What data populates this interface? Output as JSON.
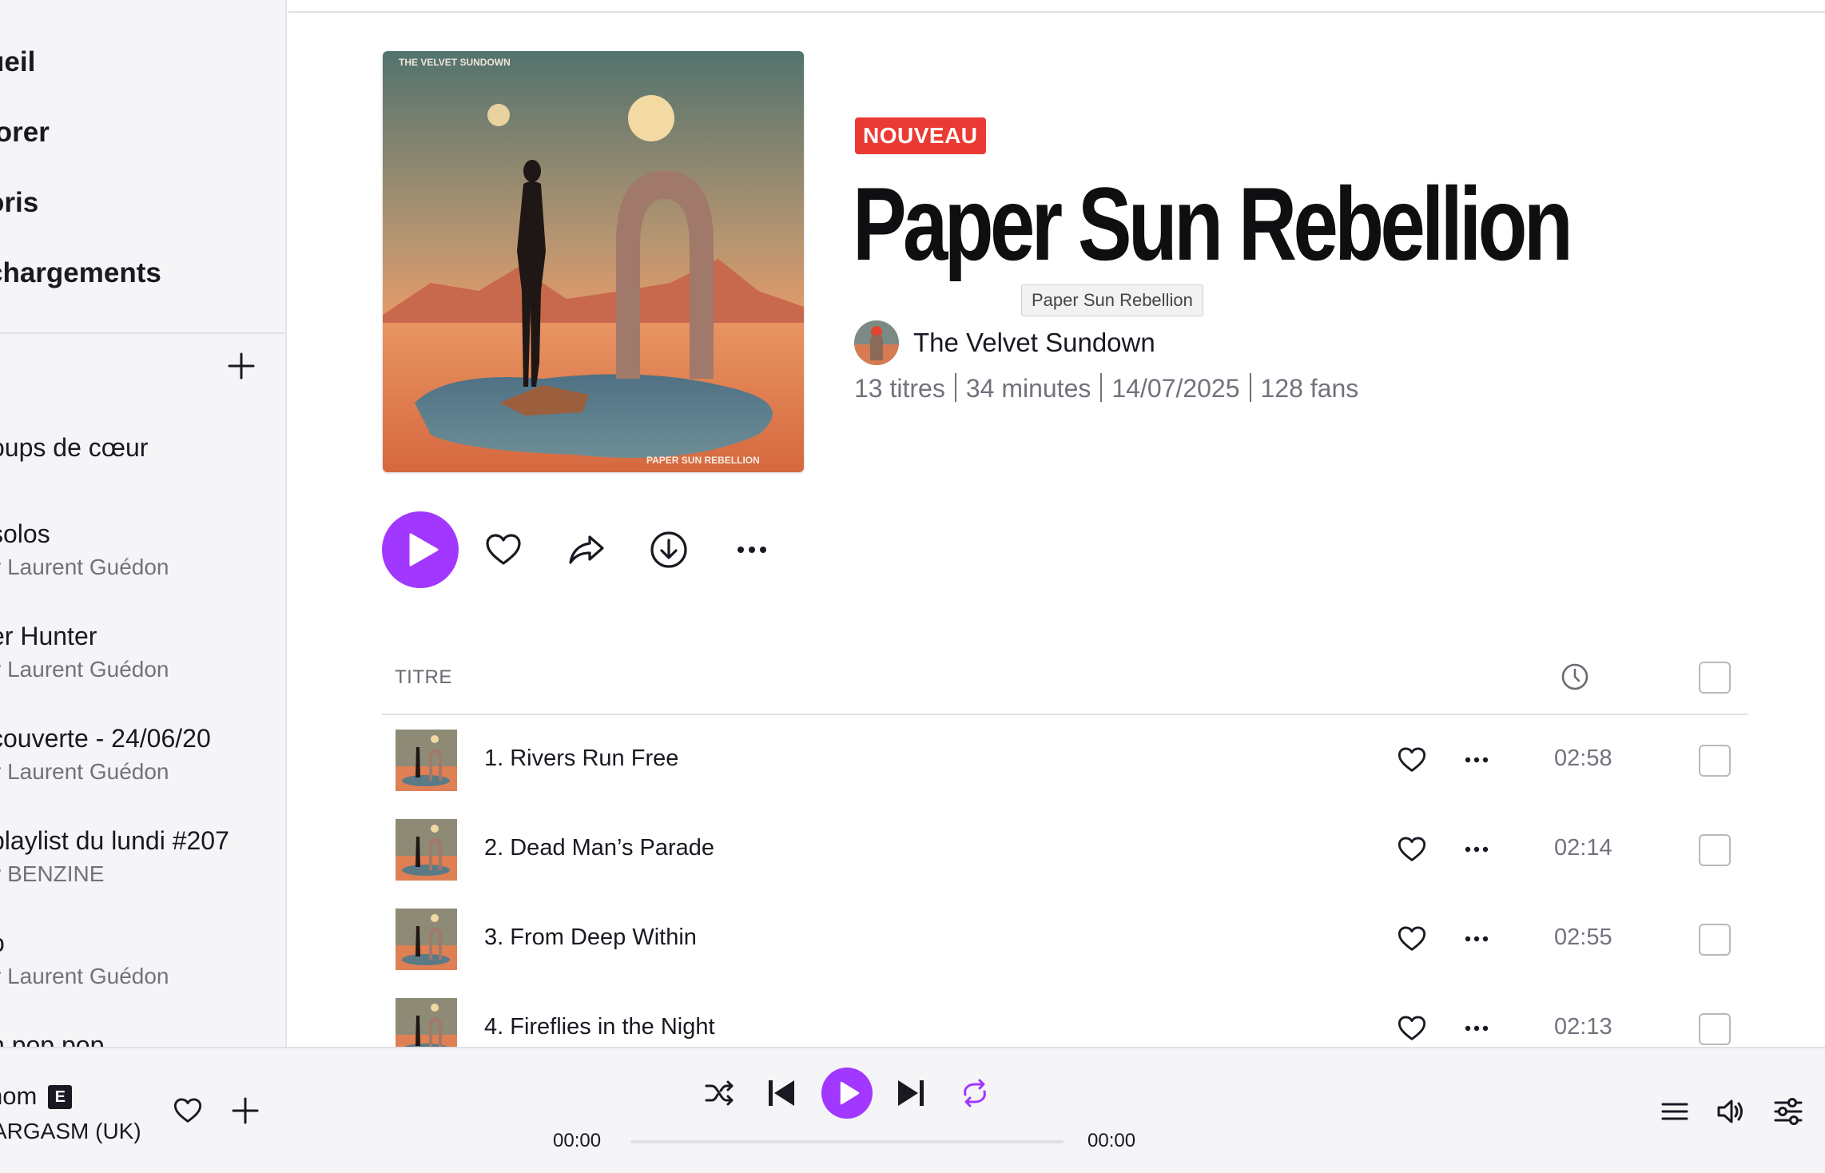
{
  "colors": {
    "accent": "#a238ff",
    "badge": "#ea3a33",
    "text": "#191922",
    "muted": "#72727d"
  },
  "sidebar": {
    "nav": [
      {
        "label": "ueil"
      },
      {
        "label": "lorer"
      },
      {
        "label": "oris"
      },
      {
        "label": "chargements"
      }
    ],
    "add_icon": "plus-icon",
    "playlists": [
      {
        "title": "oups de cœur",
        "subtitle": ""
      },
      {
        "title": "solos",
        "subtitle": "r Laurent Guédon"
      },
      {
        "title": "er Hunter",
        "subtitle": "r Laurent Guédon"
      },
      {
        "title": "couverte - 24/06/20",
        "subtitle": "r Laurent Guédon"
      },
      {
        "title": "playlist du lundi #207",
        "subtitle": "r BENZINE"
      },
      {
        "title": "o",
        "subtitle": "r Laurent Guédon"
      },
      {
        "title": "n pop pop",
        "subtitle": ""
      }
    ]
  },
  "album": {
    "cover_text_top": "THE VELVET SUNDOWN",
    "cover_text_bottom": "PAPER SUN REBELLION",
    "badge": "NOUVEAU",
    "title": "Paper Sun Rebellion",
    "tooltip": "Paper Sun Rebellion",
    "artist": "The Velvet Sundown",
    "meta": {
      "tracks": "13 titres",
      "duration": "34 minutes",
      "date": "14/07/2025",
      "fans": "128 fans"
    }
  },
  "actions": [
    "play-icon",
    "heart-icon",
    "share-icon",
    "download-icon",
    "more-icon"
  ],
  "table": {
    "header_title": "TITRE",
    "tracks": [
      {
        "title": "1. Rivers Run Free",
        "duration": "02:58"
      },
      {
        "title": "2. Dead Man’s Parade",
        "duration": "02:14"
      },
      {
        "title": "3. From Deep Within",
        "duration": "02:55"
      },
      {
        "title": "4. Fireflies in the Night",
        "duration": "02:13"
      }
    ]
  },
  "player": {
    "track_title": "nom",
    "explicit": "E",
    "track_artist": "ARGASM (UK)",
    "time_current": "00:00",
    "time_total": "00:00",
    "progress": 0
  }
}
